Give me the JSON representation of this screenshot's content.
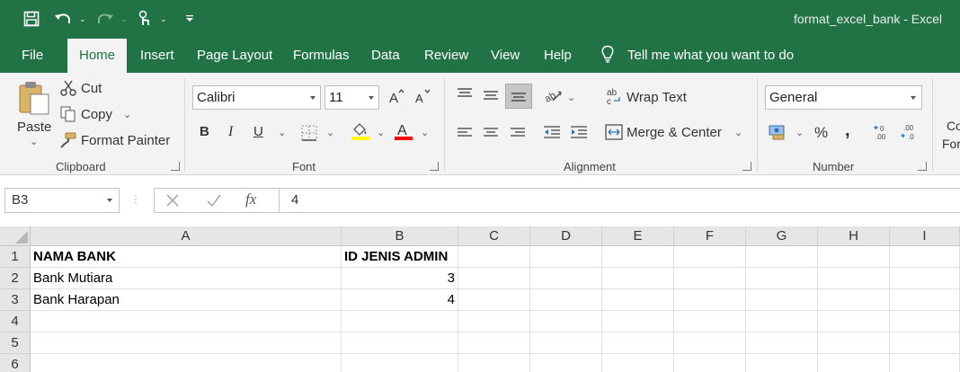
{
  "window": {
    "title": "format_excel_bank  -  Excel"
  },
  "tabs": [
    {
      "label": "File"
    },
    {
      "label": "Home"
    },
    {
      "label": "Insert"
    },
    {
      "label": "Page Layout"
    },
    {
      "label": "Formulas"
    },
    {
      "label": "Data"
    },
    {
      "label": "Review"
    },
    {
      "label": "View"
    },
    {
      "label": "Help"
    }
  ],
  "tell_me": "Tell me what you want to do",
  "clipboard": {
    "label": "Clipboard",
    "paste": "Paste",
    "cut": "Cut",
    "copy": "Copy",
    "format_painter": "Format Painter"
  },
  "font": {
    "label": "Font",
    "name": "Calibri",
    "size": "11",
    "bold": "B",
    "italic": "I",
    "underline": "U",
    "font_color": "A",
    "highlight_color": "#ffff00",
    "text_color": "#ff0000"
  },
  "alignment": {
    "label": "Alignment",
    "wrap_text": "Wrap Text",
    "merge_center": "Merge & Center"
  },
  "number": {
    "label": "Number",
    "format": "General",
    "percent": "%",
    "comma": ","
  },
  "styles_partial": {
    "line1": "Co",
    "line2": "For"
  },
  "formula_bar": {
    "name_box": "B3",
    "fx": "fx",
    "value": "4"
  },
  "sheet": {
    "columns": [
      "A",
      "B",
      "C",
      "D",
      "E",
      "F",
      "G",
      "H",
      "I"
    ],
    "rows": [
      "1",
      "2",
      "3",
      "4",
      "5",
      "6"
    ],
    "cells": {
      "A1": "NAMA BANK",
      "B1": "ID JENIS ADMIN",
      "A2": "Bank Mutiara",
      "B2": "3",
      "A3": "Bank Harapan",
      "B3": "4"
    }
  },
  "colors": {
    "accent": "#217346"
  }
}
